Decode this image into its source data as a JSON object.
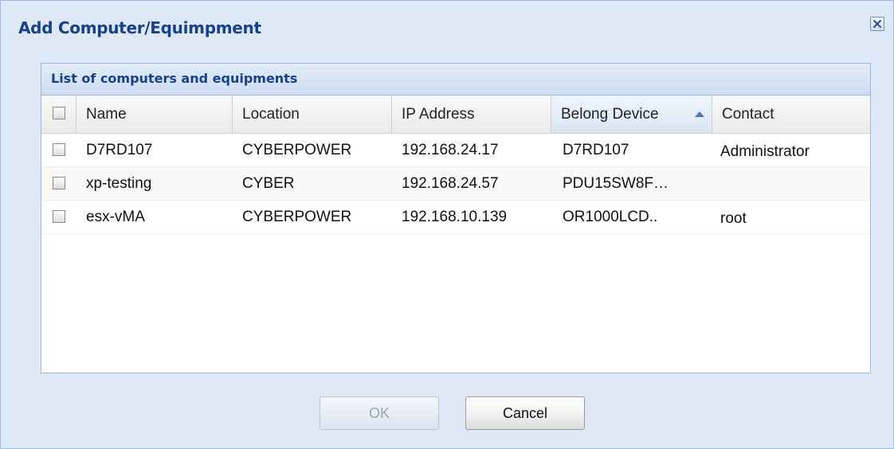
{
  "dialog": {
    "title": "Add Computer/Equimpment"
  },
  "panel": {
    "title": "List of computers and equipments"
  },
  "grid": {
    "columns": [
      "Name",
      "Location",
      "IP Address",
      "Belong Device",
      "Contact"
    ],
    "sorted_column": "Belong Device",
    "sort_direction": "ascending",
    "rows": [
      {
        "name": "D7RD107",
        "location": "CYBERPOWER",
        "ip": "192.168.24.17",
        "device": "D7RD107",
        "contact": "Administrator",
        "checked": false
      },
      {
        "name": "xp-testing",
        "location": "CYBER",
        "ip": "192.168.24.57",
        "device": "PDU15SW8F…",
        "contact": "",
        "checked": false
      },
      {
        "name": "esx-vMA",
        "location": "CYBERPOWER",
        "ip": "192.168.10.139",
        "device": "OR1000LCD..",
        "contact": "root",
        "checked": false
      }
    ]
  },
  "buttons": {
    "ok_label": "OK",
    "cancel_label": "Cancel",
    "ok_enabled": false
  },
  "colors": {
    "title": "#15428b",
    "background": "#dfe8f6",
    "border": "#99bbe8"
  },
  "icons": {
    "close": "close-icon",
    "sort": "sort-ascending-icon"
  }
}
